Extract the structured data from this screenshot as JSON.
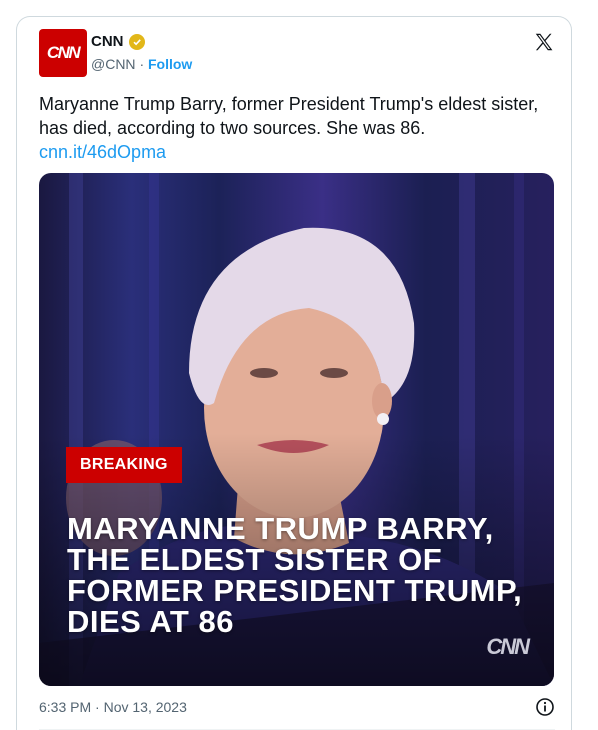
{
  "account": {
    "avatar_text": "CNN",
    "name": "CNN",
    "handle": "@CNN",
    "separator": "·",
    "follow_label": "Follow",
    "verified_color": "#e2b719"
  },
  "tweet": {
    "text": "Maryanne Trump Barry, former President Trump's eldest sister, has died, according to two sources. She was 86.",
    "link": "cnn.it/46dOpma",
    "timestamp": "6:33 PM · Nov 13, 2023"
  },
  "media": {
    "badge": "BREAKING",
    "headline": "MARYANNE TRUMP BARRY, THE ELDEST SISTER OF FORMER PRESIDENT TRUMP, DIES AT 86",
    "watermark": "CNN"
  },
  "icons": {
    "x_logo": "x-logo-icon",
    "info": "info-icon",
    "verified": "verified-badge-icon"
  },
  "colors": {
    "brand_red": "#cc0000",
    "link_blue": "#1d9bf0"
  }
}
